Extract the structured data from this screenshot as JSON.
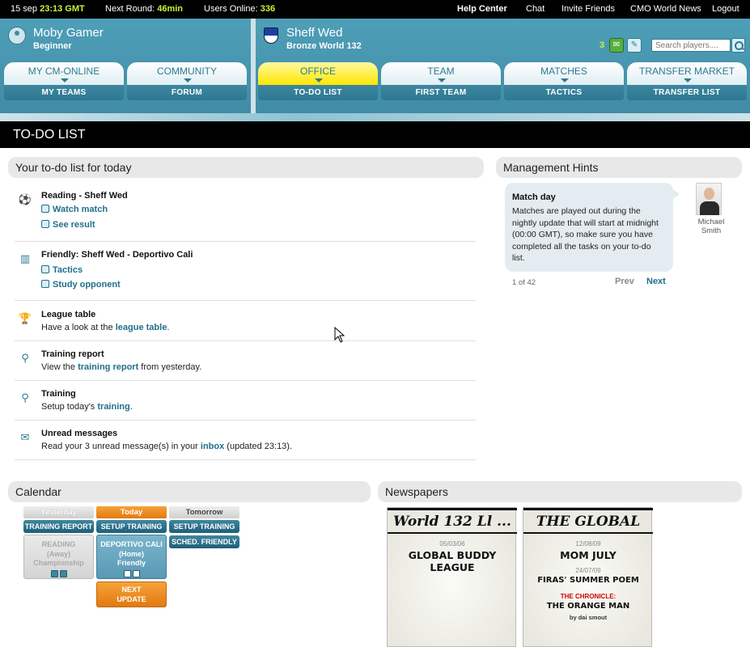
{
  "topbar": {
    "date": "15 sep",
    "time": "23:13 GMT",
    "next_round_label": "Next Round:",
    "next_round_value": "46min",
    "users_online_label": "Users Online:",
    "users_online_value": "336",
    "links": [
      "Help Center",
      "Chat",
      "Invite Friends",
      "CMO World News",
      "Logout"
    ]
  },
  "user": {
    "name": "Moby Gamer",
    "rank": "Beginner"
  },
  "club": {
    "name": "Sheff Wed",
    "league": "Bronze World 132"
  },
  "messages": {
    "count": "3"
  },
  "search": {
    "placeholder": "Search players...."
  },
  "nav": [
    {
      "top": "MY CM-ONLINE",
      "bottom": "MY TEAMS"
    },
    {
      "top": "COMMUNITY",
      "bottom": "FORUM"
    },
    {
      "top": "OFFICE",
      "bottom": "TO-DO LIST"
    },
    {
      "top": "TEAM",
      "bottom": "FIRST TEAM"
    },
    {
      "top": "MATCHES",
      "bottom": "TACTICS"
    },
    {
      "top": "TRANSFER MARKET",
      "bottom": "TRANSFER LIST"
    }
  ],
  "page_title": "TO-DO LIST",
  "todo": {
    "heading": "Your to-do list for today",
    "items": [
      {
        "title": "Reading - Sheff Wed",
        "links": [
          "Watch match",
          "See result"
        ]
      },
      {
        "title": "Friendly: Sheff Wed - Deportivo Cali",
        "links": [
          "Tactics",
          "Study opponent"
        ]
      },
      {
        "title": "League table",
        "pre": "Have a look at the ",
        "link": "league table",
        "post": "."
      },
      {
        "title": "Training report",
        "pre": "View the ",
        "link": "training report",
        "post": " from yesterday."
      },
      {
        "title": "Training",
        "pre": "Setup today's ",
        "link": "training",
        "post": "."
      },
      {
        "title": "Unread messages",
        "pre": "Read your 3 unread message(s) in your ",
        "link": "inbox",
        "post": " (updated 23:13)."
      }
    ]
  },
  "hints": {
    "heading": "Management Hints",
    "title": "Match day",
    "body": "Matches are played out during the nightly update that will start at midnight (00:00 GMT), so make sure you have completed all the tasks on your to-do list.",
    "author": "Michael Smith",
    "pager": "1 of 42",
    "prev": "Prev",
    "next": "Next"
  },
  "calendar": {
    "heading": "Calendar",
    "cols": [
      "Yesterday",
      "Today",
      "Tomorrow"
    ],
    "buttons": [
      "TRAINING REPORT",
      "SETUP TRAINING",
      "SETUP TRAINING",
      "SCHED. FRIENDLY"
    ],
    "yesterday_match": [
      "READING",
      "(Away)",
      "Championship"
    ],
    "today_match": [
      "DEPORTIVO CALI",
      "(Home)",
      "Friendly"
    ],
    "next_update": [
      "NEXT",
      "UPDATE"
    ]
  },
  "newspapers": {
    "heading": "Newspapers",
    "papers": [
      {
        "mast": "World 132 Ll ...",
        "date1": "05/03/06",
        "hl1": "GLOBAL BUDDY LEAGUE"
      },
      {
        "mast": "THE GLOBAL",
        "date1": "12/08/09",
        "hl1": "MOM JULY",
        "date2": "24/07/09",
        "hl2": "FIRAS' SUMMER POEM",
        "red": "THE CHRONICLE:",
        "hl3": "THE ORANGE MAN",
        "by": "by dai smout"
      }
    ]
  },
  "colors": {
    "teal": "#4a98b2",
    "link": "#1f6f8c",
    "accent_green": "#c8f43a",
    "active_tab": "#ffe600",
    "orange": "#f08a24"
  }
}
